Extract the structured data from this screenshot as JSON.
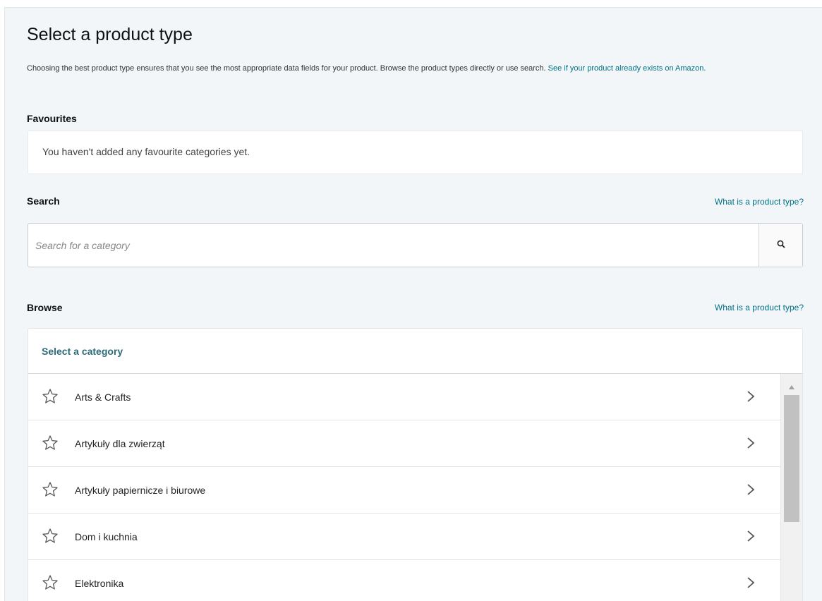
{
  "page": {
    "title": "Select a product type",
    "description": "Choosing the best product type ensures that you see the most appropriate data fields for your product. Browse the product types directly or use search.",
    "description_link": "See if your product already exists on Amazon."
  },
  "favourites": {
    "label": "Favourites",
    "empty_message": "You haven't added any favourite categories yet."
  },
  "search": {
    "label": "Search",
    "help_link": "What is a product type?",
    "placeholder": "Search for a category",
    "icon": "search-icon"
  },
  "browse": {
    "label": "Browse",
    "help_link": "What is a product type?",
    "header": "Select a category",
    "categories": [
      {
        "label": "Arts & Crafts"
      },
      {
        "label": "Artykuły dla zwierząt"
      },
      {
        "label": "Artykuły papiernicze i biurowe"
      },
      {
        "label": "Dom i kuchnia"
      },
      {
        "label": "Elektronika"
      }
    ]
  },
  "colors": {
    "link": "#007185",
    "panel_bg": "#f3f6f8",
    "category_header": "#2d6d7a"
  }
}
